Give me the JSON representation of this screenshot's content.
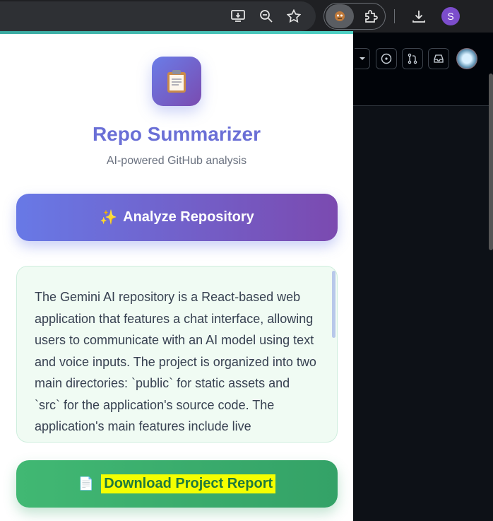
{
  "browser": {
    "profile_initial": "S"
  },
  "popup": {
    "app_icon": "clipboard-icon",
    "title": "Repo Summarizer",
    "subtitle": "AI-powered GitHub analysis",
    "analyze_button": {
      "emoji": "✨",
      "label": "Analyze Repository"
    },
    "summary": "The Gemini AI repository is a React-based web application that features a chat interface, allowing users to communicate with an AI model using text and voice inputs. The project is organized into two main directories: `public` for static assets and `src` for the application's source code. The application's main features include live transcription of speech",
    "download_button": {
      "emoji": "📄",
      "label": "Download Project Report"
    }
  },
  "colors": {
    "accent": "#6a6fd6",
    "analyze_gradient": [
      "#6879e6",
      "#7b4ab0"
    ],
    "download_green": "#3aab6d",
    "highlight": "#f4ff00"
  }
}
